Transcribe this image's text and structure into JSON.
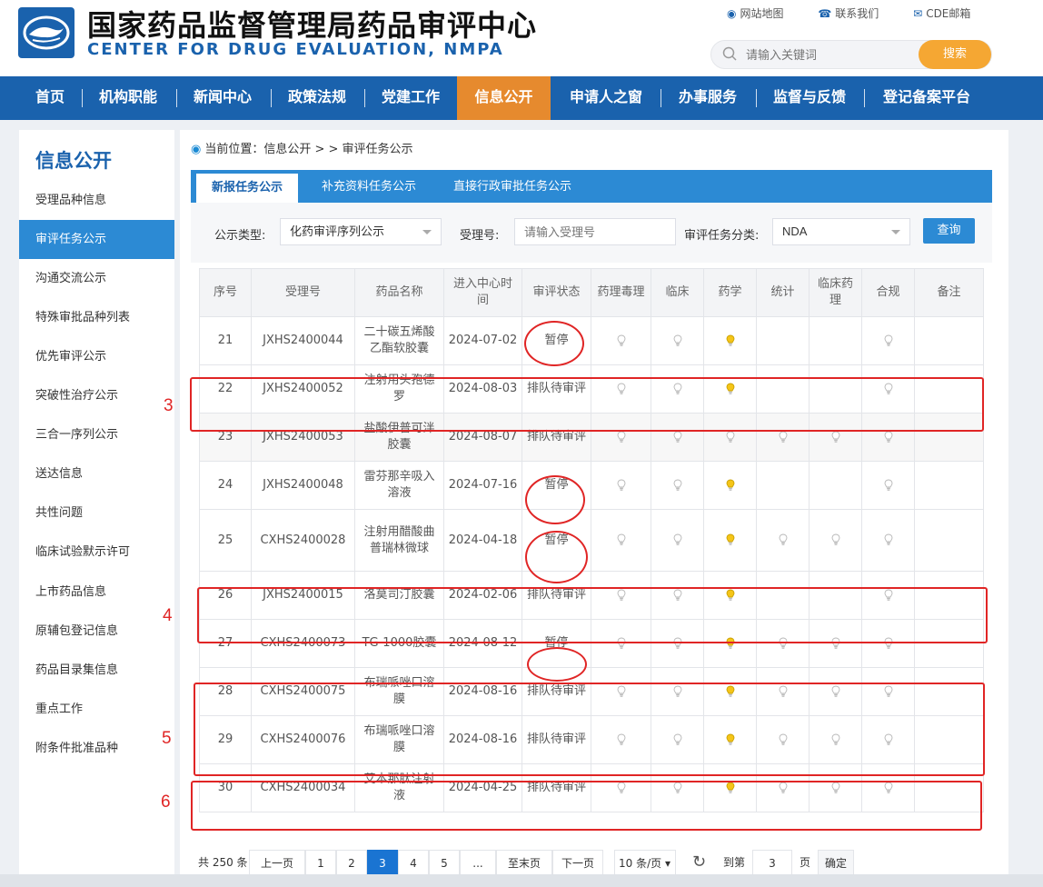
{
  "header": {
    "title_cn": "国家药品监督管理局药品审评中心",
    "title_en": "CENTER FOR DRUG EVALUATION, NMPA",
    "links": [
      "网站地图",
      "联系我们",
      "CDE邮箱"
    ],
    "search_placeholder": "请输入关键词",
    "search_button": "搜索"
  },
  "nav": [
    "首页",
    "机构职能",
    "新闻中心",
    "政策法规",
    "党建工作",
    "信息公开",
    "申请人之窗",
    "办事服务",
    "监督与反馈",
    "登记备案平台"
  ],
  "nav_active": "信息公开",
  "sidebar": {
    "title": "信息公开",
    "items": [
      "受理品种信息",
      "审评任务公示",
      "沟通交流公示",
      "特殊审批品种列表",
      "优先审评公示",
      "突破性治疗公示",
      "三合一序列公示",
      "送达信息",
      "共性问题",
      "临床试验默示许可",
      "上市药品信息",
      "原辅包登记信息",
      "药品目录集信息",
      "重点工作",
      "附条件批准品种"
    ],
    "active": "审评任务公示"
  },
  "breadcrumb": "当前位置：信息公开 > > 审评任务公示",
  "tabs": [
    "新报任务公示",
    "补充资料任务公示",
    "直接行政审批任务公示"
  ],
  "filters": {
    "type_label": "公示类型:",
    "type_value": "化药审评序列公示",
    "accept_label": "受理号:",
    "accept_placeholder": "请输入受理号",
    "category_label": "审评任务分类:",
    "category_value": "NDA",
    "query_button": "查询"
  },
  "table": {
    "headers": [
      "序号",
      "受理号",
      "药品名称",
      "进入中心时间",
      "审评状态",
      "药理毒理",
      "临床",
      "药学",
      "统计",
      "临床药理",
      "合规",
      "备注"
    ],
    "rows": [
      {
        "no": "21",
        "id": "JXHS2400044",
        "name": "二十碳五烯酸乙酯软胶囊",
        "date": "2024-07-02",
        "status": "暂停",
        "bulbs": [
          "off",
          "off",
          "on",
          "",
          "",
          "off",
          ""
        ]
      },
      {
        "no": "22",
        "id": "JXHS2400052",
        "name": "注射用头孢德罗",
        "date": "2024-08-03",
        "status": "排队待审评",
        "bulbs": [
          "off",
          "off",
          "on",
          "",
          "",
          "off",
          ""
        ]
      },
      {
        "no": "23",
        "id": "JXHS2400053",
        "name": "盐酸伊普可泮胶囊",
        "date": "2024-08-07",
        "status": "排队待审评",
        "bulbs": [
          "off",
          "off",
          "off",
          "off",
          "off",
          "off",
          ""
        ]
      },
      {
        "no": "24",
        "id": "JXHS2400048",
        "name": "雷芬那辛吸入溶液",
        "date": "2024-07-16",
        "status": "暂停",
        "bulbs": [
          "off",
          "off",
          "on",
          "",
          "",
          "off",
          ""
        ]
      },
      {
        "no": "25",
        "id": "CXHS2400028",
        "name": "注射用醋酸曲普瑞林微球",
        "date": "2024-04-18",
        "status": "暂停",
        "bulbs": [
          "off",
          "off",
          "on",
          "off",
          "off",
          "off",
          ""
        ]
      },
      {
        "no": "26",
        "id": "JXHS2400015",
        "name": "洛莫司汀胶囊",
        "date": "2024-02-06",
        "status": "排队待审评",
        "bulbs": [
          "off",
          "off",
          "on",
          "",
          "",
          "off",
          ""
        ]
      },
      {
        "no": "27",
        "id": "CXHS2400073",
        "name": "TG-1000胶囊",
        "date": "2024-08-12",
        "status": "暂停",
        "bulbs": [
          "off",
          "off",
          "on",
          "off",
          "off",
          "off",
          ""
        ]
      },
      {
        "no": "28",
        "id": "CXHS2400075",
        "name": "布瑞哌唑口溶膜",
        "date": "2024-08-16",
        "status": "排队待审评",
        "bulbs": [
          "off",
          "off",
          "on",
          "off",
          "off",
          "off",
          ""
        ]
      },
      {
        "no": "29",
        "id": "CXHS2400076",
        "name": "布瑞哌唑口溶膜",
        "date": "2024-08-16",
        "status": "排队待审评",
        "bulbs": [
          "off",
          "off",
          "on",
          "off",
          "off",
          "off",
          ""
        ]
      },
      {
        "no": "30",
        "id": "CXHS2400034",
        "name": "艾本那肽注射液",
        "date": "2024-04-25",
        "status": "排队待审评",
        "bulbs": [
          "off",
          "off",
          "on",
          "off",
          "off",
          "off",
          ""
        ]
      }
    ]
  },
  "pagination": {
    "total": "共 250 条",
    "prev": "上一页",
    "pages": [
      "1",
      "2",
      "3",
      "4",
      "5",
      "..."
    ],
    "current": "3",
    "last": "至末页",
    "next": "下一页",
    "page_size": "10 条/页",
    "goto_label": "到第",
    "goto_value": "3",
    "page_unit": "页",
    "confirm": "确定"
  },
  "annotations": {
    "labels": [
      "3",
      "4",
      "5",
      "6"
    ],
    "color": "#e02525"
  },
  "colors": {
    "brand_blue": "#1a62ad",
    "nav_active": "#e68a2e",
    "tab_blue": "#2c8ad4",
    "search_button": "#f5a733",
    "bulb_on": "#f5c518"
  }
}
